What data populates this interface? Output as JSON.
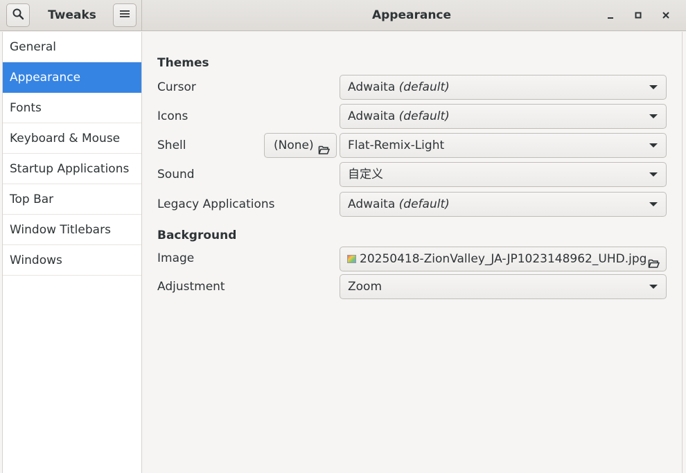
{
  "window": {
    "app_title": "Tweaks",
    "page_title": "Appearance"
  },
  "icons": {
    "search": "search-icon",
    "menu": "hamburger-menu-icon",
    "minimize": "minimize-icon",
    "maximize": "maximize-icon",
    "close": "close-icon",
    "folder": "folder-open-icon",
    "image": "image-file-icon",
    "dropdown": "chevron-down-icon"
  },
  "colors": {
    "selected": "#3584e4"
  },
  "sidebar": {
    "items": [
      {
        "label": "General"
      },
      {
        "label": "Appearance"
      },
      {
        "label": "Fonts"
      },
      {
        "label": "Keyboard & Mouse"
      },
      {
        "label": "Startup Applications"
      },
      {
        "label": "Top Bar"
      },
      {
        "label": "Window Titlebars"
      },
      {
        "label": "Windows"
      }
    ],
    "selected": "Appearance"
  },
  "themes": {
    "title": "Themes",
    "cursor": {
      "label": "Cursor",
      "value": "Adwaita",
      "value_suffix": "(default)"
    },
    "icons": {
      "label": "Icons",
      "value": "Adwaita",
      "value_suffix": "(default)"
    },
    "shell": {
      "label": "Shell",
      "button_label": "(None)",
      "value": "Flat-Remix-Light"
    },
    "sound": {
      "label": "Sound",
      "value": "自定义"
    },
    "legacy": {
      "label": "Legacy Applications",
      "value": "Adwaita",
      "value_suffix": "(default)"
    }
  },
  "background": {
    "title": "Background",
    "image": {
      "label": "Image",
      "value": "20250418-ZionValley_JA-JP1023148962_UHD.jpg"
    },
    "adjustment": {
      "label": "Adjustment",
      "value": "Zoom"
    }
  }
}
